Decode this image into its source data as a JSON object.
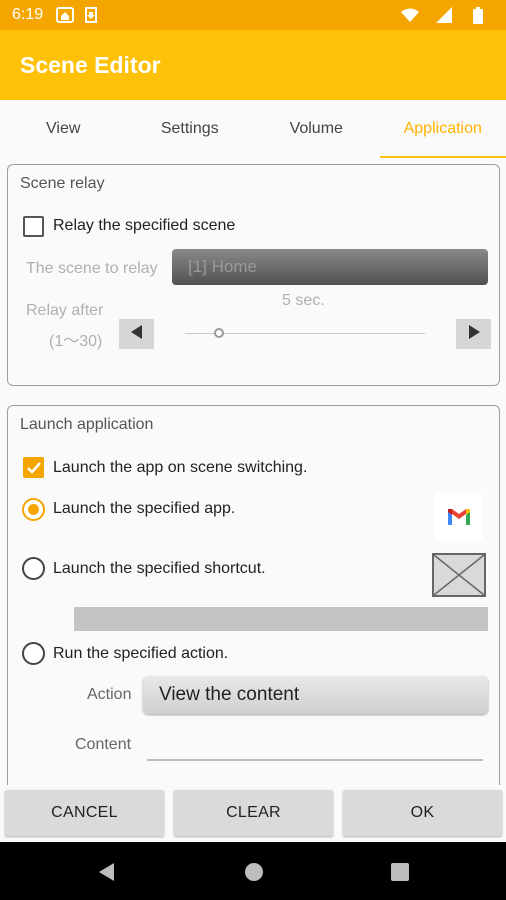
{
  "status_bar": {
    "time": "6:19"
  },
  "app_bar": {
    "title": "Scene Editor"
  },
  "tabs": [
    {
      "label": "View",
      "active": false
    },
    {
      "label": "Settings",
      "active": false
    },
    {
      "label": "Volume",
      "active": false
    },
    {
      "label": "Application",
      "active": true
    }
  ],
  "scene_relay": {
    "title": "Scene relay",
    "relay_checkbox_label": "Relay the specified scene",
    "relay_checked": false,
    "scene_label": "The scene to relay",
    "scene_value": "[1] Home",
    "relay_after_label": "Relay after",
    "relay_after_range": "(1〜30)",
    "relay_after_value": "5 sec.",
    "slider_fraction": 0.14
  },
  "launch_application": {
    "title": "Launch application",
    "launch_checkbox_label": "Launch the app on scene switching.",
    "launch_checked": true,
    "options": [
      {
        "label": "Launch the specified app.",
        "selected": true
      },
      {
        "label": "Launch the specified shortcut.",
        "selected": false
      },
      {
        "label": "Run the specified action.",
        "selected": false
      }
    ],
    "action_label": "Action",
    "action_value": "View the content",
    "content_label": "Content",
    "content_value": ""
  },
  "buttons": {
    "cancel": "CANCEL",
    "clear": "CLEAR",
    "ok": "OK"
  },
  "colors": {
    "accent": "#ffc107",
    "accent_dark": "#f5a500",
    "status_bar": "#f5a500"
  },
  "icons": [
    "home-icon",
    "download-icon",
    "wifi-icon",
    "signal-icon",
    "battery-icon",
    "gmail-icon",
    "back-icon",
    "home-nav-icon",
    "recents-icon"
  ]
}
